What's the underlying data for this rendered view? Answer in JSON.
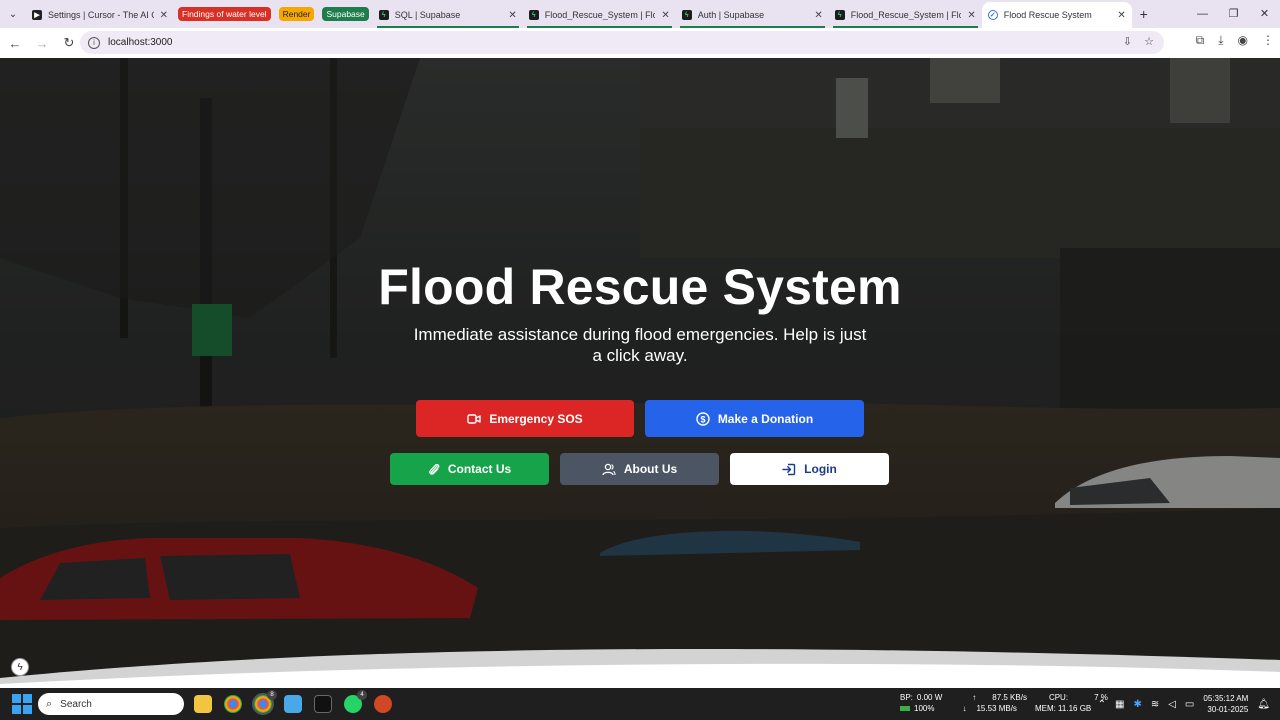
{
  "browser": {
    "tabs": [
      {
        "title": "Settings | Cursor - The AI Code",
        "favicon": "cursor-icon"
      },
      {
        "title": "SQL | Supabase",
        "favicon": "supabase-icon"
      },
      {
        "title": "Flood_Rescue_System | Flood",
        "favicon": "supabase-icon"
      },
      {
        "title": "Auth | Supabase",
        "favicon": "supabase-icon"
      },
      {
        "title": "Flood_Rescue_System | Flood",
        "favicon": "supabase-icon"
      },
      {
        "title": "Flood Rescue System",
        "favicon": "globe-icon"
      }
    ],
    "chips": [
      {
        "label": "Findings of water level",
        "color": "#d93025"
      },
      {
        "label": "Render",
        "color": "#f6a800"
      },
      {
        "label": "Supabase",
        "color": "#1e7d4a"
      }
    ],
    "url": "localhost:3000"
  },
  "hero": {
    "title": "Flood Rescue System",
    "subtitle": "Immediate assistance during flood emergencies. Help is just a click away.",
    "buttons": {
      "sos": "Emergency SOS",
      "donate": "Make a Donation",
      "contact": "Contact Us",
      "about": "About Us",
      "login": "Login"
    }
  },
  "taskbar": {
    "search": "Search",
    "chrome_badge": "8",
    "whatsapp_badge": "4",
    "stats": {
      "bp_label": "BP:",
      "bp_value": "0.00 W",
      "battery": "100%",
      "up": "87.5 KB/s",
      "down": "15.53 MB/s",
      "cpu_label": "CPU:",
      "cpu_value": "7 %",
      "mem": "MEM: 11.16 GB"
    },
    "time": "05:35:12 AM",
    "date": "30-01-2025"
  }
}
